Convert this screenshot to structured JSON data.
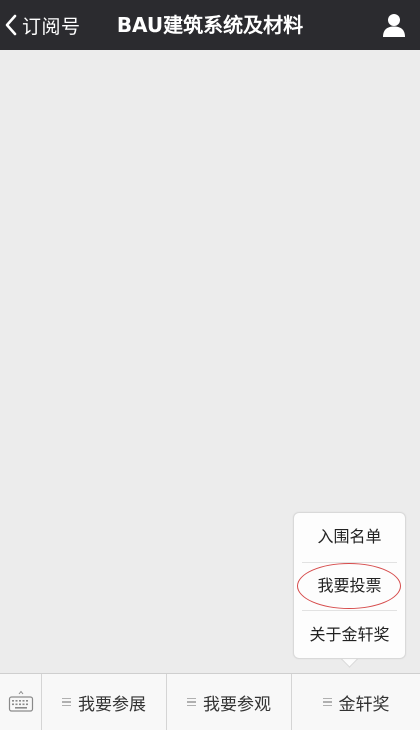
{
  "header": {
    "back_label": "订阅号",
    "title": "BAU建筑系统及材料"
  },
  "popup": {
    "items": [
      {
        "label": "入围名单"
      },
      {
        "label": "我要投票"
      },
      {
        "label": "关于金轩奖"
      }
    ]
  },
  "bottom_menu": {
    "tabs": [
      {
        "label": "我要参展"
      },
      {
        "label": "我要参观"
      },
      {
        "label": "金轩奖"
      }
    ]
  },
  "colors": {
    "header_bg": "#2b2b2f",
    "content_bg": "#ececec",
    "highlight_circle": "#d64b4b"
  },
  "icons": {
    "back": "chevron-left-icon",
    "profile": "person-icon",
    "keyboard": "keyboard-icon",
    "menu": "menu-lines-icon"
  }
}
